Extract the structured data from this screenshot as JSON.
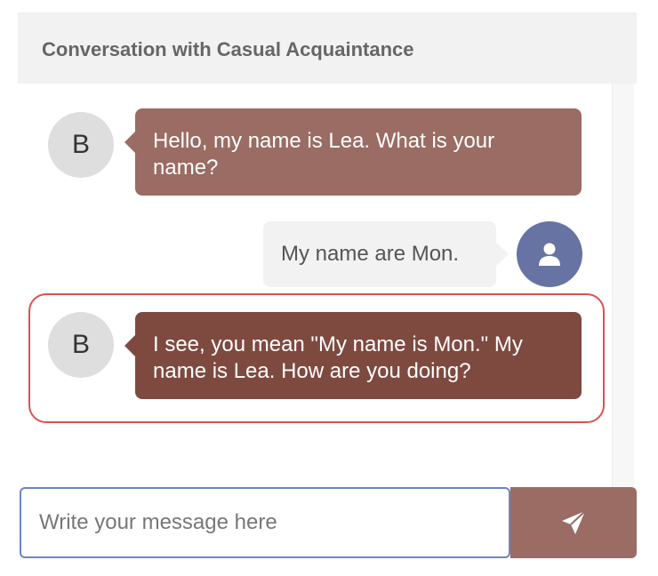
{
  "header": {
    "title": "Conversation with Casual Acquaintance"
  },
  "messages": [
    {
      "sender": "bot",
      "avatar_letter": "B",
      "text": "Hello, my name is Lea. What is your name?"
    },
    {
      "sender": "user",
      "avatar_icon": "user-icon",
      "text": "My name are Mon."
    },
    {
      "sender": "bot",
      "avatar_letter": "B",
      "text": "I see, you mean \"My name is Mon.\" My name is Lea. How are you doing?",
      "highlighted": true
    }
  ],
  "composer": {
    "placeholder": "Write your message here",
    "value": "",
    "send_icon": "send-icon"
  },
  "colors": {
    "bot_bubble": "#9a6c63",
    "bot_bubble_highlighted": "#7e4a40",
    "user_avatar": "#6673a3",
    "highlight_border": "#d9534f",
    "input_focus_border": "#6a86c8",
    "send_button": "#9a6c63"
  }
}
